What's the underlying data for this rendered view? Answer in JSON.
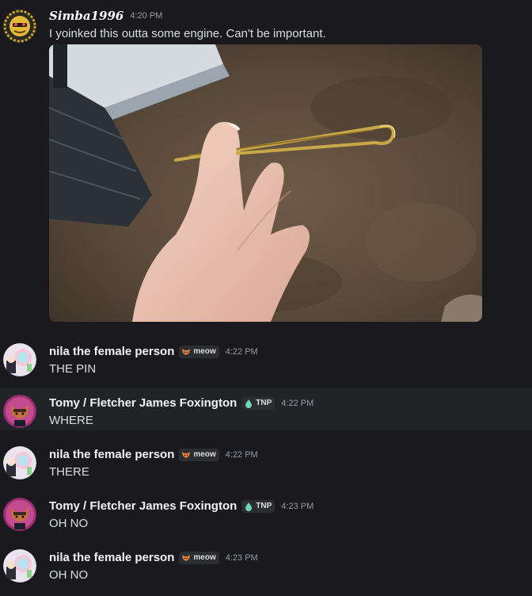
{
  "messages": [
    {
      "username": "Simba1996",
      "time": "4:20 PM",
      "text": "I yoinked this outta some engine. Can't be important."
    },
    {
      "username": "nila the female person",
      "tag": "meow",
      "time": "4:22 PM",
      "text": "THE PIN"
    },
    {
      "username": "Tomy / Fletcher James Foxington",
      "tag": "TNP",
      "time": "4:22 PM",
      "text": "WHERE"
    },
    {
      "username": "nila the female person",
      "tag": "meow",
      "time": "4:22 PM",
      "text": "THERE"
    },
    {
      "username": "Tomy / Fletcher James Foxington",
      "tag": "TNP",
      "time": "4:23 PM",
      "text": "OH NO"
    },
    {
      "username": "nila the female person",
      "tag": "meow",
      "time": "4:23 PM",
      "text": "OH NO"
    }
  ],
  "colors": {
    "background": "#1a1a1e",
    "hover_row": "#222327",
    "username": "#f2f3f5",
    "timestamp": "#949ba4",
    "text": "#dbdee1"
  },
  "icons": {
    "meow_tag": "fox-icon",
    "tnp_tag": "drop-icon"
  }
}
